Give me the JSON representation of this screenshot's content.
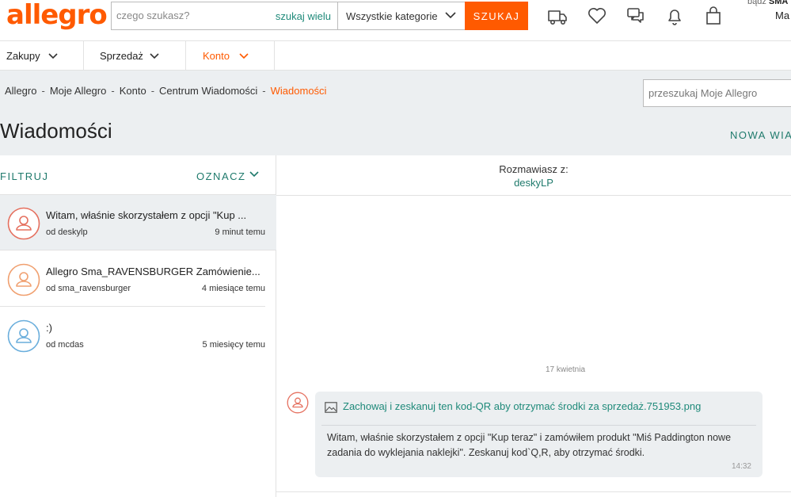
{
  "header": {
    "logo": "allegro",
    "search_placeholder": "czego szukasz?",
    "search_multi": "szukaj wielu",
    "category": "Wszystkie kategorie",
    "search_button": "SZUKAJ",
    "corner_top_prefix": "bądź ",
    "corner_top_bold": "SMA",
    "corner_bottom": "Ma"
  },
  "menu": {
    "items": [
      {
        "label": "Zakupy"
      },
      {
        "label": "Sprzedaż"
      },
      {
        "label": "Konto"
      }
    ]
  },
  "breadcrumb": {
    "items": [
      "Allegro",
      "Moje Allegro",
      "Konto",
      "Centrum Wiadomości"
    ],
    "current": "Wiadomości",
    "separator": "-"
  },
  "moje_search_placeholder": "przeszukaj Moje Allegro",
  "page_title": "Wiadomości",
  "new_message": "NOWA WIA",
  "list": {
    "filter": "FILTRUJ",
    "mark": "OZNACZ",
    "conversations": [
      {
        "subject": "Witam, właśnie skorzystałem z opcji \"Kup ...",
        "from": "od deskylp",
        "when": "9 minut temu",
        "avatar_color": "#e5705f"
      },
      {
        "subject": "Allegro Sma_RAVENSBURGER Zamówienie...",
        "from": "od sma_ravensburger",
        "when": "4 miesiące temu",
        "avatar_color": "#f0a070"
      },
      {
        "subject": ":)",
        "from": "od mcdas",
        "when": "5 miesięcy temu",
        "avatar_color": "#6aaedc"
      }
    ]
  },
  "chat": {
    "label": "Rozmawiasz z:",
    "partner": "deskyLP",
    "date": "17 kwietnia",
    "attachment": "Zachowaj i zeskanuj ten kod-QR aby otrzymać środki za sprzedaż.751953.png",
    "message": "Witam, właśnie skorzystałem z opcji \"Kup teraz\" i zamówiłem produkt \"Miś Paddington nowe zadania do wyklejania naklejki\". Zeskanuj kod`Q,R, aby otrzymać środki.",
    "time": "14:32"
  },
  "colors": {
    "brand": "#ff5a00",
    "teal": "#1f7a6c",
    "panel_gray": "#eceff1"
  }
}
